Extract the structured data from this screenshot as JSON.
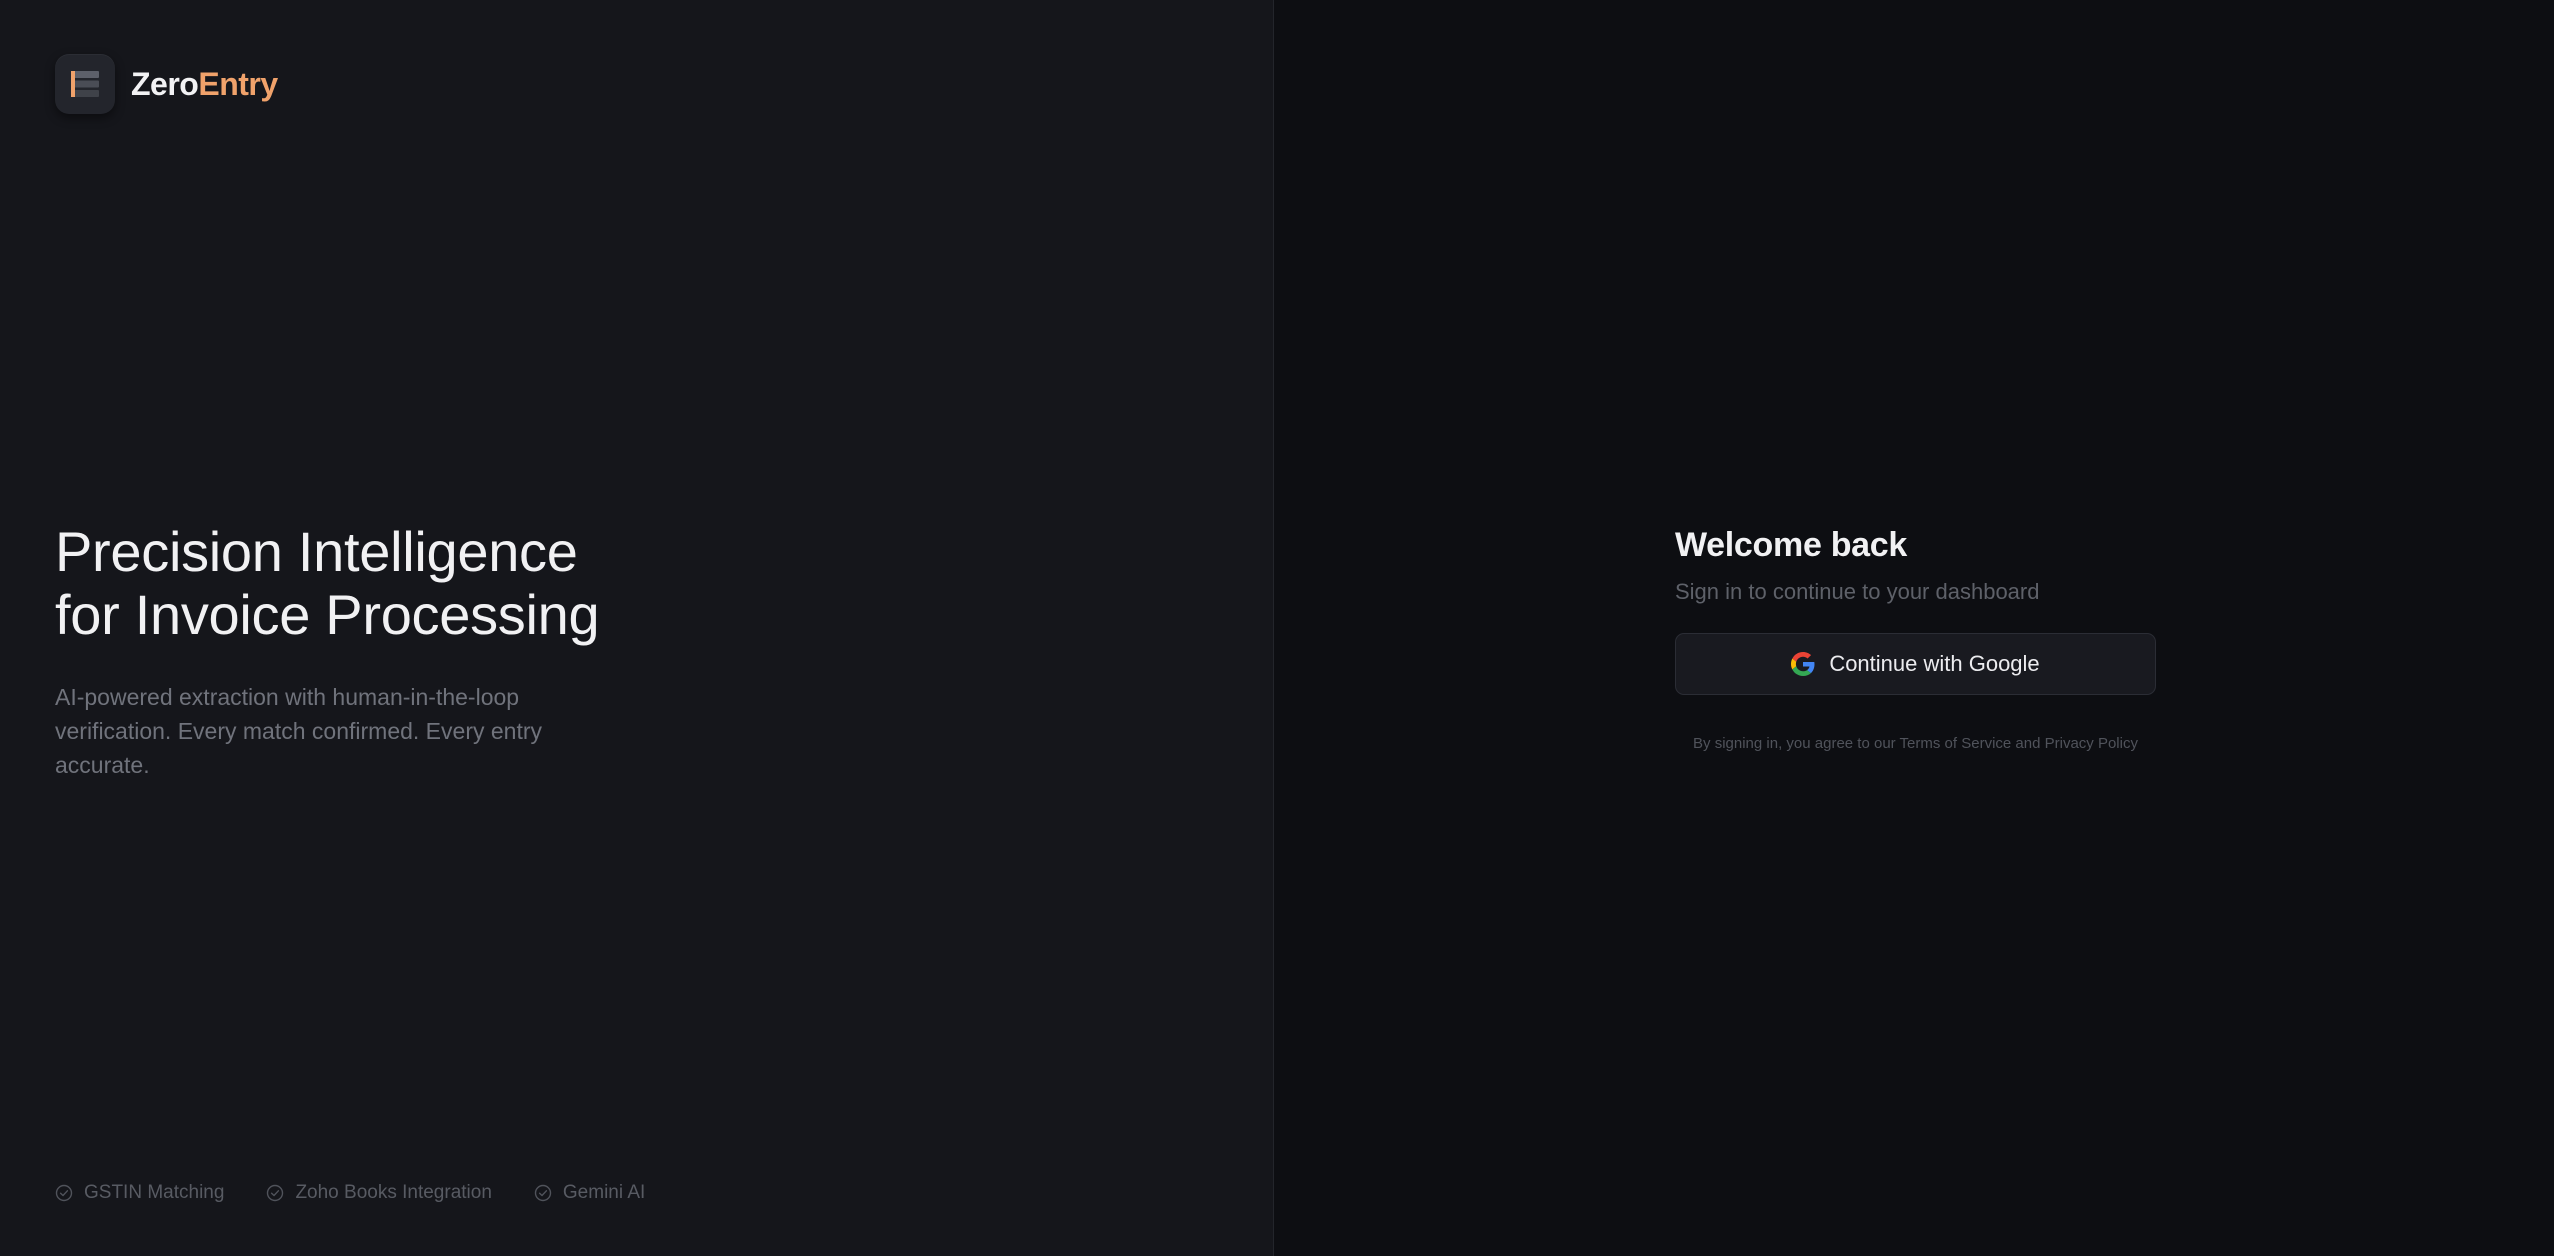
{
  "brand": {
    "name_primary": "Zero",
    "name_accent": "Entry",
    "icon": "invoice-stack-icon",
    "accent_color": "#f0a26b"
  },
  "hero": {
    "title_line1": "Precision Intelligence",
    "title_line2": "for Invoice Processing",
    "subtitle": "AI-powered extraction with human-in-the-loop verification. Every match confirmed. Every entry accurate."
  },
  "features": [
    {
      "icon": "check-circle-icon",
      "label": "GSTIN Matching"
    },
    {
      "icon": "check-circle-icon",
      "label": "Zoho Books Integration"
    },
    {
      "icon": "check-circle-icon",
      "label": "Gemini AI"
    }
  ],
  "signin": {
    "title": "Welcome back",
    "subtitle": "Sign in to continue to your dashboard",
    "google_button_label": "Continue with Google",
    "google_icon": "google-icon",
    "legal_text": "By signing in, you agree to our Terms of Service and Privacy Policy"
  }
}
